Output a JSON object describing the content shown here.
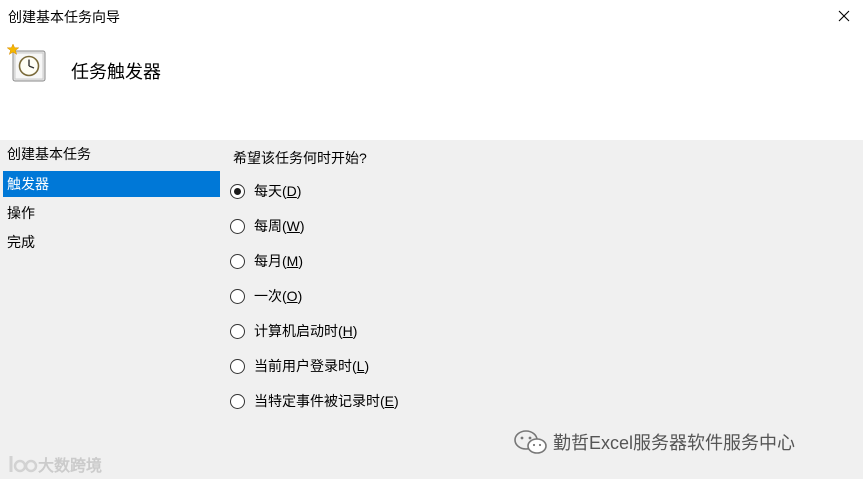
{
  "window": {
    "title": "创建基本任务向导"
  },
  "header": {
    "heading": "任务触发器"
  },
  "sidebar": {
    "items": [
      {
        "label": "创建基本任务",
        "selected": false
      },
      {
        "label": "触发器",
        "selected": true
      },
      {
        "label": "操作",
        "selected": false
      },
      {
        "label": "完成",
        "selected": false
      }
    ]
  },
  "main": {
    "question": "希望该任务何时开始?",
    "options": [
      {
        "text": "每天",
        "key": "D",
        "checked": true
      },
      {
        "text": "每周",
        "key": "W",
        "checked": false
      },
      {
        "text": "每月",
        "key": "M",
        "checked": false
      },
      {
        "text": "一次",
        "key": "O",
        "checked": false
      },
      {
        "text": "计算机启动时",
        "key": "H",
        "checked": false
      },
      {
        "text": "当前用户登录时",
        "key": "L",
        "checked": false
      },
      {
        "text": "当特定事件被记录时",
        "key": "E",
        "checked": false
      }
    ]
  },
  "watermarks": {
    "left_text": "大数跨境",
    "right_text": "勤哲Excel服务器软件服务中心"
  },
  "colors": {
    "selection": "#0078d7",
    "background": "#f0f0f0",
    "header": "#ffffff"
  }
}
